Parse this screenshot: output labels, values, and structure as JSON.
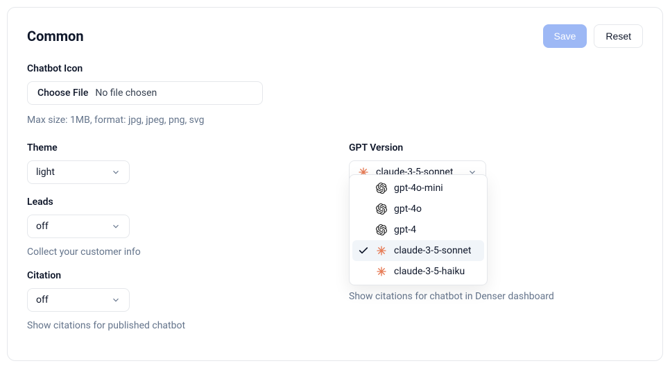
{
  "header": {
    "title": "Common",
    "save_label": "Save",
    "reset_label": "Reset"
  },
  "chatbot_icon": {
    "label": "Chatbot Icon",
    "choose_file_label": "Choose File",
    "file_status": "No file chosen",
    "hint": "Max size: 1MB, format: jpg, jpeg, png, svg"
  },
  "theme": {
    "label": "Theme",
    "value": "light"
  },
  "leads": {
    "label": "Leads",
    "value": "off",
    "help": "Collect your customer info"
  },
  "citation": {
    "label": "Citation",
    "value": "off",
    "help": "Show citations for published chatbot"
  },
  "gpt": {
    "label": "GPT Version",
    "selected": "claude-3-5-sonnet",
    "options": [
      {
        "value": "gpt-4o-mini",
        "icon": "openai"
      },
      {
        "value": "gpt-4o",
        "icon": "openai"
      },
      {
        "value": "gpt-4",
        "icon": "openai"
      },
      {
        "value": "claude-3-5-sonnet",
        "icon": "anthropic",
        "selected": true
      },
      {
        "value": "claude-3-5-haiku",
        "icon": "anthropic"
      }
    ]
  },
  "right_bottom_help": "Show citations for chatbot in Denser dashboard"
}
